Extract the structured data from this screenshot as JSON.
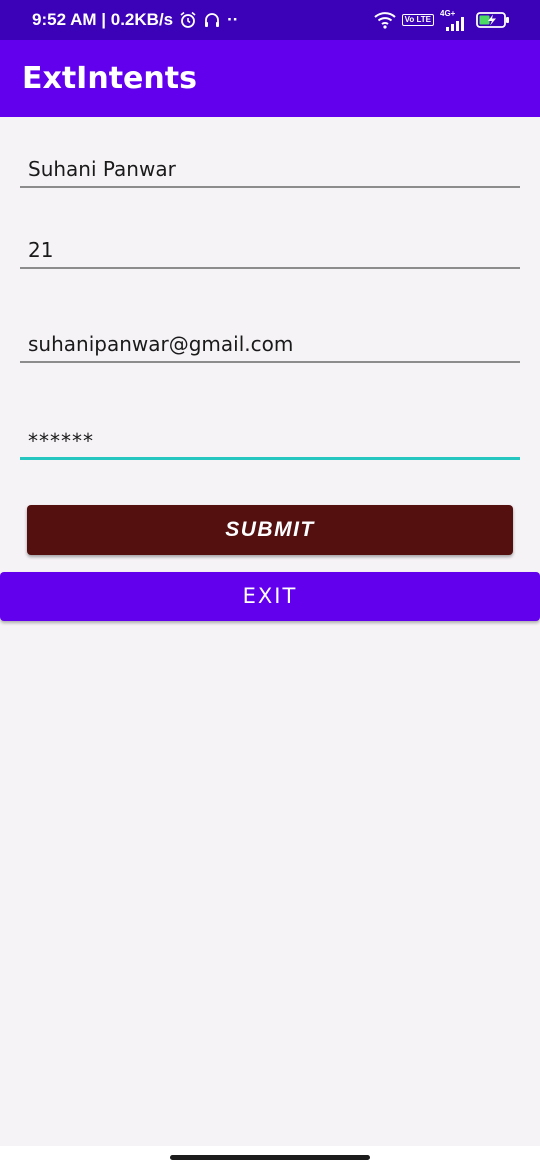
{
  "status_bar": {
    "time_speed": "9:52 AM | 0.2KB/s",
    "overflow_dots": "··",
    "volte_label": "Vo LTE",
    "network_label": "4G+"
  },
  "app": {
    "title": "ExtIntents"
  },
  "form": {
    "name_value": "Suhani Panwar",
    "age_value": "21",
    "email_value": "suhanipanwar@gmail.com",
    "password_value": "******"
  },
  "buttons": {
    "submit_label": "SUBMIT",
    "exit_label": "EXIT"
  },
  "colors": {
    "status_bar": "#3c02b8",
    "app_bar": "#6200ee",
    "submit_button": "#540f0f",
    "exit_button": "#6200ee",
    "focus_underline": "#26c6c0",
    "background": "#f6f3f7"
  }
}
